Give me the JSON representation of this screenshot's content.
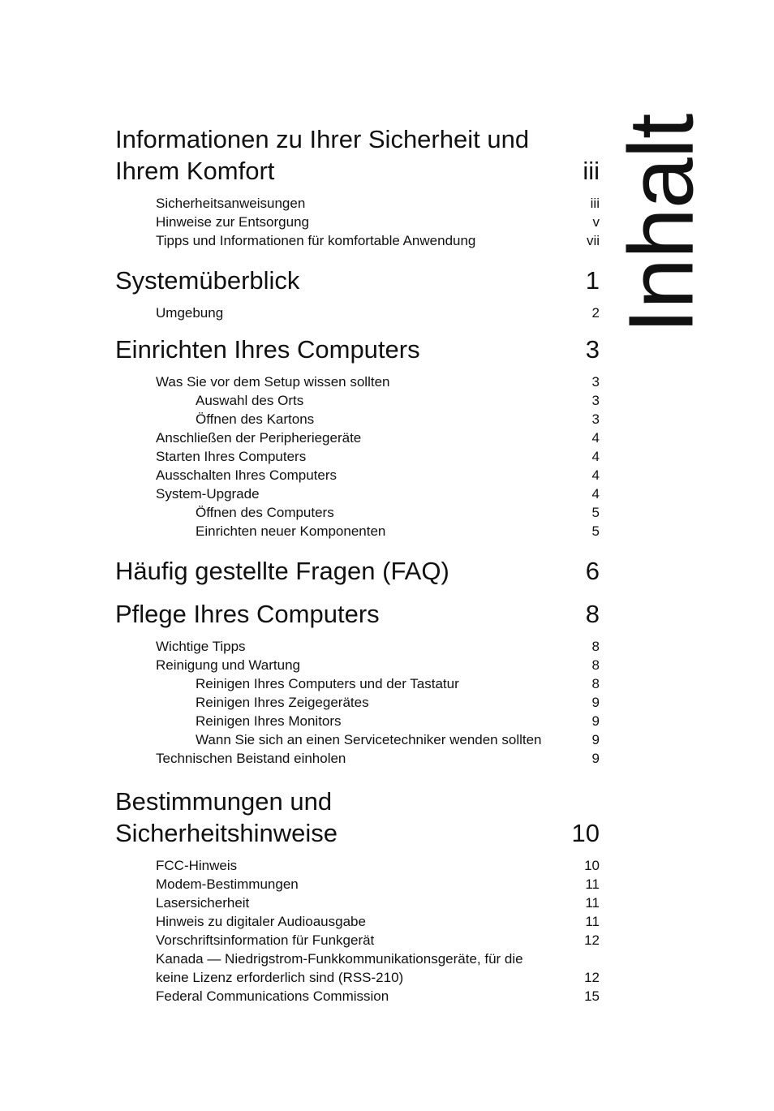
{
  "vertical_title": "Inhalt",
  "sections": [
    {
      "title": "Informationen zu Ihrer Sicherheit und\nIhrem Komfort",
      "page": "iii",
      "entries": [
        {
          "level": 1,
          "title": "Sicherheitsanweisungen",
          "page": "iii"
        },
        {
          "level": 1,
          "title": "Hinweise zur Entsorgung",
          "page": "v"
        },
        {
          "level": 1,
          "title": "Tipps und Informationen für komfortable Anwendung",
          "page": "vii"
        }
      ]
    },
    {
      "title": "Systemüberblick",
      "page": "1",
      "entries": [
        {
          "level": 1,
          "title": "Umgebung",
          "page": "2"
        }
      ]
    },
    {
      "title": "Einrichten Ihres Computers",
      "page": "3",
      "entries": [
        {
          "level": 1,
          "title": "Was Sie vor dem Setup wissen sollten",
          "page": "3"
        },
        {
          "level": 2,
          "title": "Auswahl des Orts",
          "page": "3"
        },
        {
          "level": 2,
          "title": "Öffnen des Kartons",
          "page": "3"
        },
        {
          "level": 1,
          "title": "Anschließen der Peripheriegeräte",
          "page": "4"
        },
        {
          "level": 1,
          "title": "Starten Ihres Computers",
          "page": "4"
        },
        {
          "level": 1,
          "title": "Ausschalten Ihres Computers",
          "page": "4"
        },
        {
          "level": 1,
          "title": "System-Upgrade",
          "page": "4"
        },
        {
          "level": 2,
          "title": "Öffnen des Computers",
          "page": "5"
        },
        {
          "level": 2,
          "title": "Einrichten neuer Komponenten",
          "page": "5"
        }
      ]
    },
    {
      "title": "Häufig gestellte Fragen (FAQ)",
      "page": "6",
      "entries": []
    },
    {
      "title": "Pflege Ihres Computers",
      "page": "8",
      "entries": [
        {
          "level": 1,
          "title": "Wichtige Tipps",
          "page": "8"
        },
        {
          "level": 1,
          "title": "Reinigung und Wartung",
          "page": "8"
        },
        {
          "level": 2,
          "title": "Reinigen Ihres Computers und der Tastatur",
          "page": "8"
        },
        {
          "level": 2,
          "title": "Reinigen Ihres Zeigegerätes",
          "page": "9"
        },
        {
          "level": 2,
          "title": "Reinigen Ihres Monitors",
          "page": "9"
        },
        {
          "level": 2,
          "title": "Wann Sie sich an einen Servicetechniker wenden sollten",
          "page": "9"
        },
        {
          "level": 1,
          "title": "Technischen Beistand einholen",
          "page": "9"
        }
      ]
    },
    {
      "title": "Bestimmungen und\nSicherheitshinweise",
      "page": "10",
      "entries": [
        {
          "level": 1,
          "title": "FCC-Hinweis",
          "page": "10"
        },
        {
          "level": 1,
          "title": "Modem-Bestimmungen",
          "page": "11"
        },
        {
          "level": 1,
          "title": "Lasersicherheit",
          "page": "11"
        },
        {
          "level": 1,
          "title": "Hinweis zu digitaler Audioausgabe",
          "page": "11"
        },
        {
          "level": 1,
          "title": "Vorschriftsinformation für Funkgerät",
          "page": "12"
        },
        {
          "level": 1,
          "title": "Kanada — Niedrigstrom-Funkkommunikationsgeräte, für die\nkeine Lizenz erforderlich sind (RSS-210)",
          "page": "12"
        },
        {
          "level": 1,
          "title": "Federal Communications Commission",
          "page": "15"
        }
      ]
    }
  ]
}
